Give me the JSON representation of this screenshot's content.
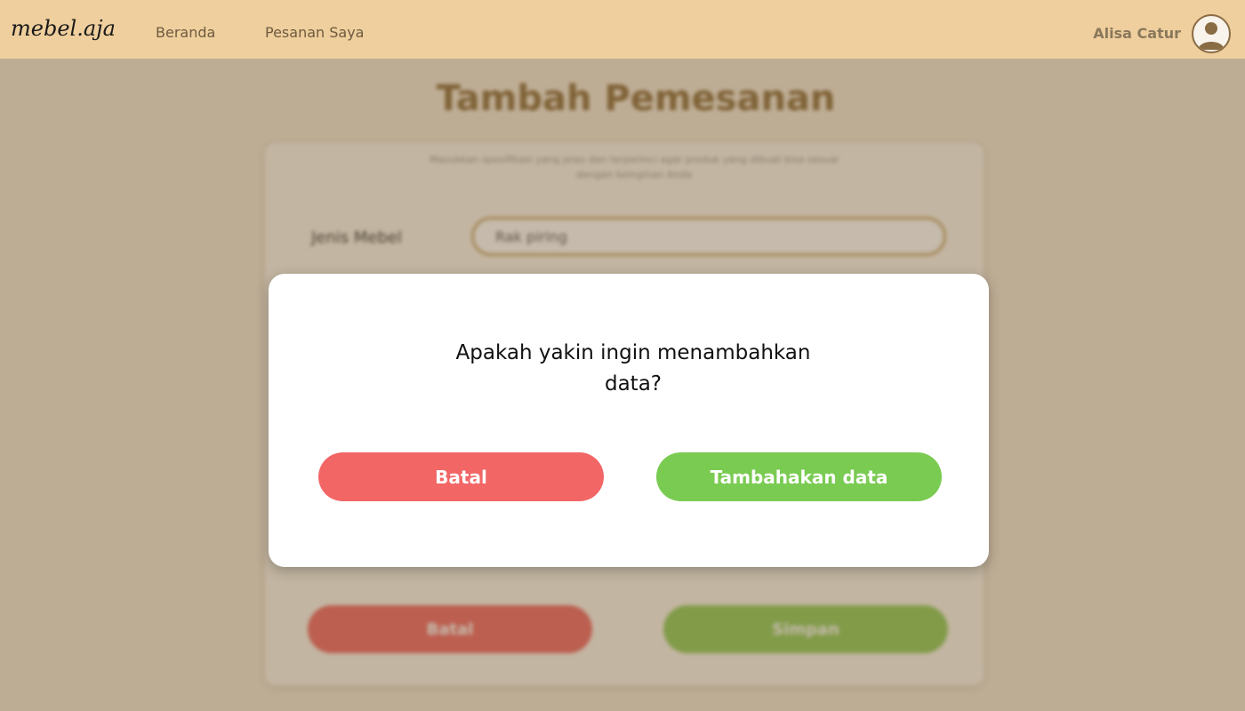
{
  "navbar": {
    "logo": "mebel.aja",
    "links": [
      "Beranda",
      "Pesanan Saya"
    ],
    "user_name": "Alisa Catur"
  },
  "page": {
    "title": "Tambah Pemesanan",
    "subtitle": "Masukkan spesifikasi yang jelas dan terperinci agar produk yang dibuat bisa sesuai dengan keinginan Anda",
    "field_label": "Jenis Mebel",
    "field_value": "Rak piring",
    "cancel_label": "Batal",
    "save_label": "Simpan"
  },
  "modal": {
    "message": "Apakah yakin ingin menambahkan data?",
    "cancel_label": "Batal",
    "confirm_label": "Tambahakan data"
  },
  "colors": {
    "navbar_bg": "#efcf9d",
    "cancel": "#f26666",
    "confirm": "#7acb52"
  }
}
